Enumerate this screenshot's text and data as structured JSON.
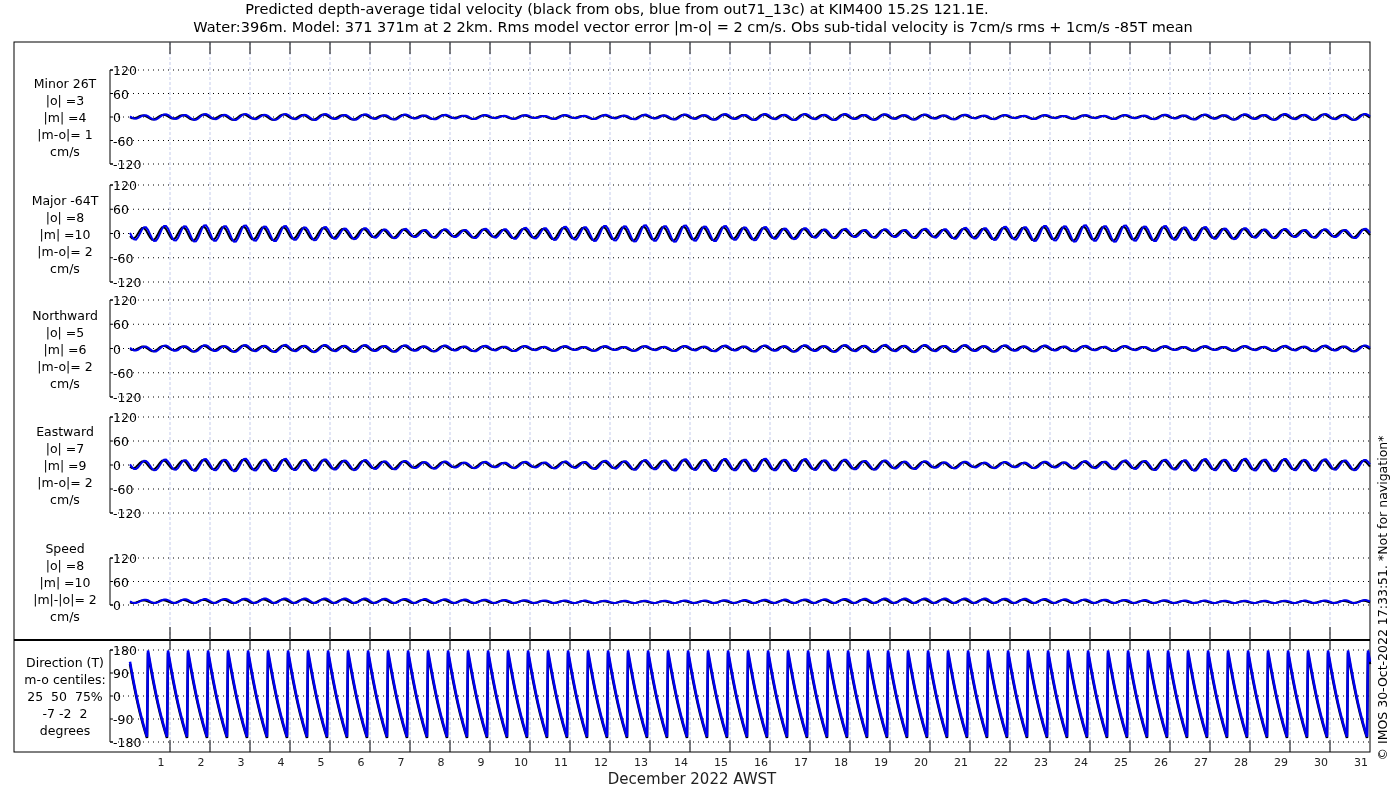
{
  "title_lines": [
    "Predicted depth-average tidal velocity (black from obs, blue from out71_13c) at KIM400 15.2S 121.1E.",
    "Water:396m. Model: 371 371m at 2 2km. Rms model vector error |m-o| = 2 cm/s. Obs sub-tidal velocity is 7cm/s rms + 1cm/s -85T mean"
  ],
  "panels": [
    {
      "kind": "signed",
      "labels": [
        "Minor 26T",
        "|o| =3",
        "|m| =4",
        "|m-o|= 1",
        "cm/s"
      ],
      "yticks": [
        "120",
        "60",
        "0",
        "-60",
        "-120"
      ]
    },
    {
      "kind": "signed",
      "labels": [
        "Major -64T",
        "|o| =8",
        "|m| =10",
        "|m-o|= 2",
        "cm/s"
      ],
      "yticks": [
        "120",
        "60",
        "0",
        "-60",
        "-120"
      ]
    },
    {
      "kind": "signed",
      "labels": [
        "Northward",
        "|o| =5",
        "|m| =6",
        "|m-o|= 2",
        "cm/s"
      ],
      "yticks": [
        "120",
        "60",
        "0",
        "-60",
        "-120"
      ]
    },
    {
      "kind": "signed",
      "labels": [
        "Eastward",
        "|o| =7",
        "|m| =9",
        "|m-o|= 2",
        "cm/s"
      ],
      "yticks": [
        "120",
        "60",
        "0",
        "-60",
        "-120"
      ]
    },
    {
      "kind": "speed",
      "labels": [
        "Speed",
        "|o| =8",
        "|m| =10",
        "|m|-|o|= 2",
        "cm/s"
      ],
      "yticks": [
        "120",
        "60",
        "0"
      ]
    },
    {
      "kind": "direction",
      "labels": [
        "Direction (T)",
        "m-o centiles:",
        "25  50  75%",
        "-7 -2  2",
        "degrees"
      ],
      "yticks": [
        "180",
        "90",
        "0",
        "-90",
        "-180"
      ]
    }
  ],
  "days": [
    "1",
    "2",
    "3",
    "4",
    "5",
    "6",
    "7",
    "8",
    "9",
    "10",
    "11",
    "12",
    "13",
    "14",
    "15",
    "16",
    "17",
    "18",
    "19",
    "20",
    "21",
    "22",
    "23",
    "24",
    "25",
    "26",
    "27",
    "28",
    "29",
    "30",
    "31"
  ],
  "xlabel": "December 2022 AWST",
  "copyright": "© IMOS 30-Oct-2022 17:33:51. *Not for navigation*"
}
